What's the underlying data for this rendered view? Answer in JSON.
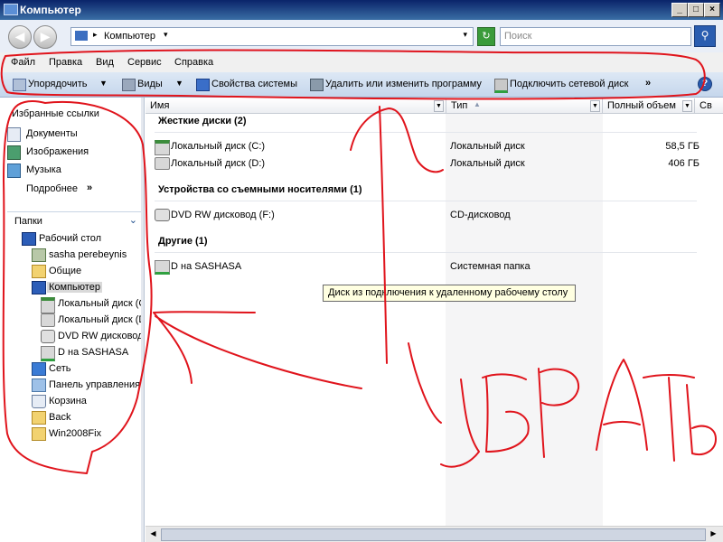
{
  "window": {
    "title": "Компьютер",
    "btn_min": "_",
    "btn_max": "□",
    "btn_close": "×"
  },
  "address": {
    "path": "Компьютер",
    "search_placeholder": "Поиск"
  },
  "menu": {
    "items": [
      "Файл",
      "Правка",
      "Вид",
      "Сервис",
      "Справка"
    ]
  },
  "toolbar": {
    "organize": "Упорядочить",
    "views": "Виды",
    "system_props": "Свойства системы",
    "uninstall": "Удалить или изменить программу",
    "map_drive": "Подключить сетевой диск",
    "more": "»",
    "help": "?"
  },
  "favorites": {
    "title": "Избранные ссылки",
    "items": [
      {
        "label": "Документы",
        "icon": "documents-icon"
      },
      {
        "label": "Изображения",
        "icon": "pictures-icon"
      },
      {
        "label": "Музыка",
        "icon": "music-icon"
      }
    ],
    "more": "Подробнее",
    "more_chevron": "»"
  },
  "folders": {
    "title": "Папки",
    "chevron": "⌄",
    "tree": [
      {
        "label": "Рабочий стол",
        "icon": "desktop-icon"
      },
      {
        "label": "sasha perebeynis",
        "icon": "user-folder-icon"
      },
      {
        "label": "Общие",
        "icon": "folder-icon"
      },
      {
        "label": "Компьютер",
        "icon": "computer-icon",
        "selected": true
      },
      {
        "label": "Локальный диск (C",
        "icon": "system-drive-icon"
      },
      {
        "label": "Локальный диск (D",
        "icon": "drive-icon"
      },
      {
        "label": "DVD RW дисковод",
        "icon": "dvd-drive-icon"
      },
      {
        "label": "D на SASHASA",
        "icon": "network-drive-icon"
      },
      {
        "label": "Сеть",
        "icon": "network-icon"
      },
      {
        "label": "Панель управления",
        "icon": "control-panel-icon"
      },
      {
        "label": "Корзина",
        "icon": "recycle-bin-icon"
      },
      {
        "label": "Back",
        "icon": "folder-icon"
      },
      {
        "label": "Win2008Fix",
        "icon": "folder-icon"
      }
    ]
  },
  "columns": {
    "name": "Имя",
    "type": "Тип",
    "total": "Полный объем",
    "free": "Св"
  },
  "groups": [
    {
      "title": "Жесткие диски (2)",
      "items": [
        {
          "name": "Локальный диск (C:)",
          "type": "Локальный диск",
          "size": "58,5 ГБ",
          "icon": "system-drive-icon"
        },
        {
          "name": "Локальный диск (D:)",
          "type": "Локальный диск",
          "size": "406 ГБ",
          "icon": "drive-icon"
        }
      ]
    },
    {
      "title": "Устройства со съемными носителями (1)",
      "items": [
        {
          "name": "DVD RW дисковод (F:)",
          "type": "CD-дисковод",
          "size": "",
          "icon": "dvd-drive-icon"
        }
      ]
    },
    {
      "title": "Другие (1)",
      "items": [
        {
          "name": "D на SASHASA",
          "type": "Системная папка",
          "size": "",
          "icon": "network-drive-icon"
        }
      ]
    }
  ],
  "tooltip": "Диск из подключения к удаленному рабочему столу",
  "colors": {
    "annotation": "#e0141c",
    "titlebar": "#0a246a",
    "tooltip_bg": "#ffffe1"
  }
}
